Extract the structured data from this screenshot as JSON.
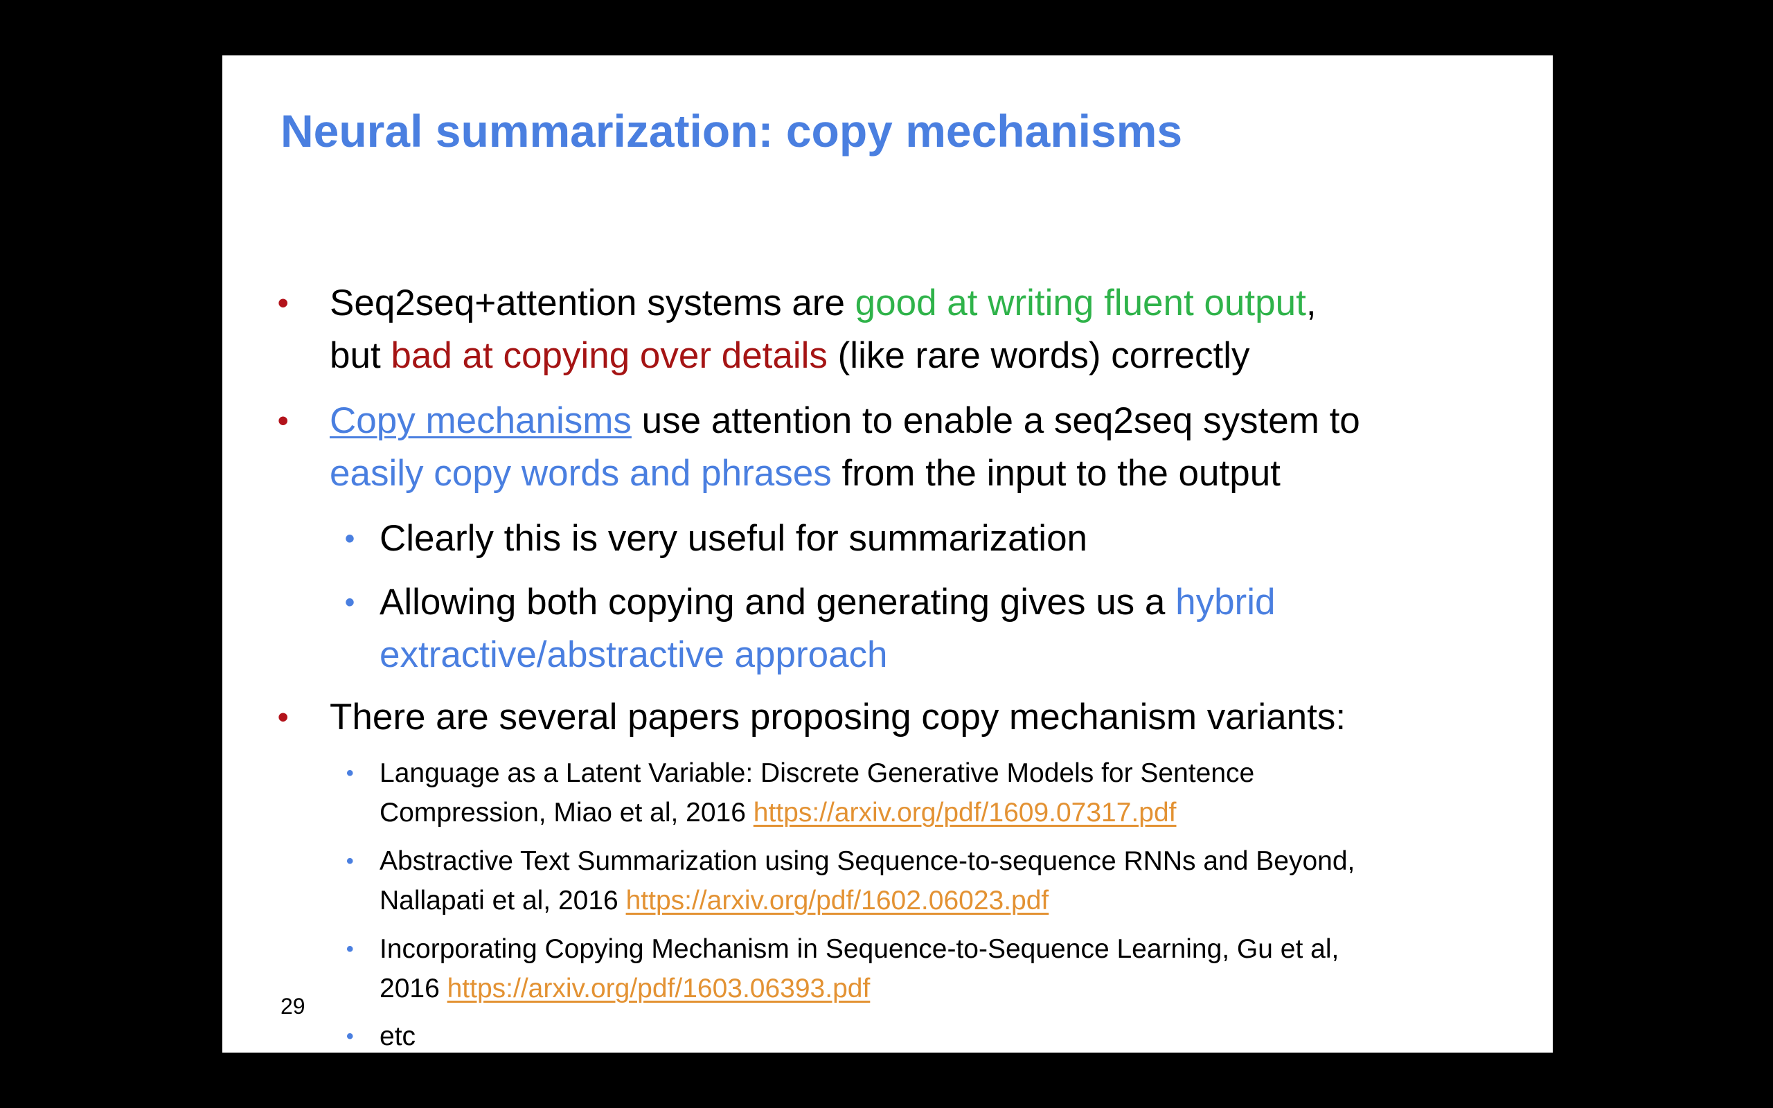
{
  "theme": {
    "title_color": "#4a7fe0",
    "green": "#2fb34a",
    "red": "#a51414",
    "blue": "#4a7fe0",
    "link": "#e39233",
    "bullet_red": "#b3131b",
    "bullet_blue": "#4a7fe0"
  },
  "slide": {
    "title": "Neural summarization: copy mechanisms",
    "page_number": "29",
    "bullets": [
      {
        "bullet_char": "•",
        "parts": [
          "Seq2seq+attention systems are ",
          "good at writing fluent output",
          ",",
          "but ",
          "bad at copying over details",
          " (like rare words) correctly"
        ]
      },
      {
        "bullet_char": "•",
        "parts": [
          "Copy mechanisms",
          " use attention to enable a seq2seq system to",
          "easily copy words and phrases",
          " from the input to the output"
        ],
        "sub": [
          {
            "bullet_char": "•",
            "text": "Clearly this is very useful for summarization"
          },
          {
            "bullet_char": "•",
            "parts": [
              "Allowing both copying and generating gives us a ",
              "hybrid",
              "extractive/abstractive approach"
            ]
          }
        ]
      },
      {
        "bullet_char": "•",
        "text": "There are several papers proposing copy mechanism variants:",
        "refs": [
          {
            "bullet_char": "•",
            "line1": "Language as a Latent Variable: Discrete Generative Models for Sentence",
            "line2": "Compression, Miao et al, 2016 ",
            "url": "https://arxiv.org/pdf/1609.07317.pdf"
          },
          {
            "bullet_char": "•",
            "line1": "Abstractive Text Summarization using Sequence-to-sequence RNNs and Beyond,",
            "line2": "Nallapati et al, 2016 ",
            "url": "https://arxiv.org/pdf/1602.06023.pdf"
          },
          {
            "bullet_char": "•",
            "line1": "Incorporating Copying Mechanism in Sequence-to-Sequence Learning, Gu et al,",
            "line2": "2016 ",
            "url": "https://arxiv.org/pdf/1603.06393.pdf"
          },
          {
            "bullet_char": "•",
            "line1": "etc"
          }
        ]
      }
    ]
  }
}
